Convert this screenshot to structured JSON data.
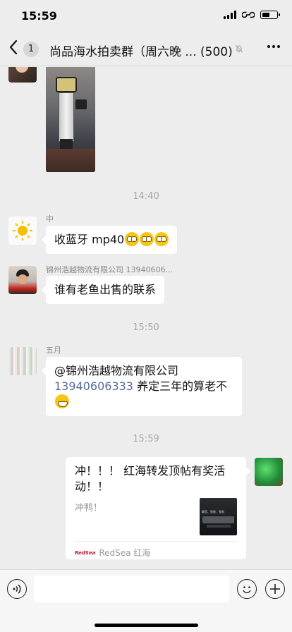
{
  "status_bar": {
    "time": "15:59",
    "battery_level": 0.55
  },
  "nav": {
    "back_icon": "chevron-left-icon",
    "unread_count": "1",
    "title": "尚品海水拍卖群（周六晚 ...",
    "member_count": "(500)",
    "mute_icon": "bell-slash-icon",
    "more_icon": "ellipsis-icon"
  },
  "messages": [
    {
      "type": "image",
      "side": "left",
      "content": "photo of a protein skimmer"
    },
    {
      "type": "time",
      "text": "14:40"
    },
    {
      "type": "text",
      "side": "left",
      "sender": "中",
      "text": "收蓝牙 mp40",
      "emojis": [
        "flushed",
        "flushed",
        "flushed"
      ]
    },
    {
      "type": "text",
      "side": "left",
      "sender": "锦州浩越物流有限公司 13940606...",
      "text": "谁有老鱼出售的联系"
    },
    {
      "type": "time",
      "text": "15:50"
    },
    {
      "type": "text",
      "side": "left",
      "sender": "五月",
      "mention": "@锦州浩越物流有限公司",
      "mention_phone": "13940606333",
      "text": " 养定三年的算老不",
      "emojis": [
        "grin"
      ]
    },
    {
      "type": "time",
      "text": "15:59"
    },
    {
      "type": "link_card",
      "side": "right",
      "title": "冲！！！ 红海转发顶帖有奖活动！！",
      "description": "冲鸭！",
      "thumb_text": "静音、智能、强劲",
      "source_logo": "RedSea",
      "source": "RedSea 红海"
    }
  ],
  "input_bar": {
    "voice_icon": "voice-icon",
    "input_value": "",
    "emoji_icon": "smiley-icon",
    "plus_icon": "plus-icon"
  },
  "colors": {
    "background": "#ededed",
    "bubble": "#ffffff",
    "mention": "#576b95",
    "timestamp": "#a8a8a8"
  }
}
